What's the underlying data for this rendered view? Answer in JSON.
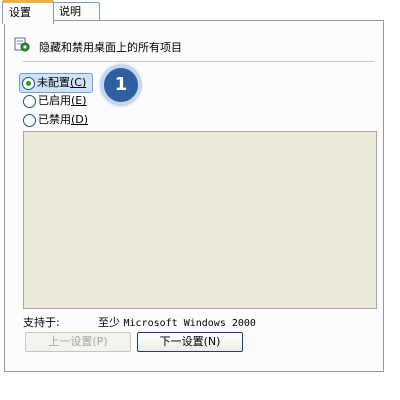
{
  "tabs": [
    {
      "label": "设置"
    },
    {
      "label": "说明"
    }
  ],
  "policy": {
    "title": "隐藏和禁用桌面上的所有项目",
    "icon": "policy-setting-icon"
  },
  "options": [
    {
      "label": "未配置",
      "accel": "(C)",
      "checked": true
    },
    {
      "label": "已启用",
      "accel": "(E)",
      "checked": false
    },
    {
      "label": "已禁用",
      "accel": "(D)",
      "checked": false
    }
  ],
  "callout": {
    "number": "1"
  },
  "supported": {
    "label": "支持于:",
    "prefix": "至少",
    "value": "Microsoft Windows 2000"
  },
  "buttons": {
    "prev": "上一设置(P)",
    "next": "下一设置(N)"
  },
  "colors": {
    "active_tab_accent": "#f0b040",
    "selection_highlight": "#cfe2f6",
    "callout_fill": "#2f5fa0",
    "panel_gray": "#ece9d8"
  }
}
